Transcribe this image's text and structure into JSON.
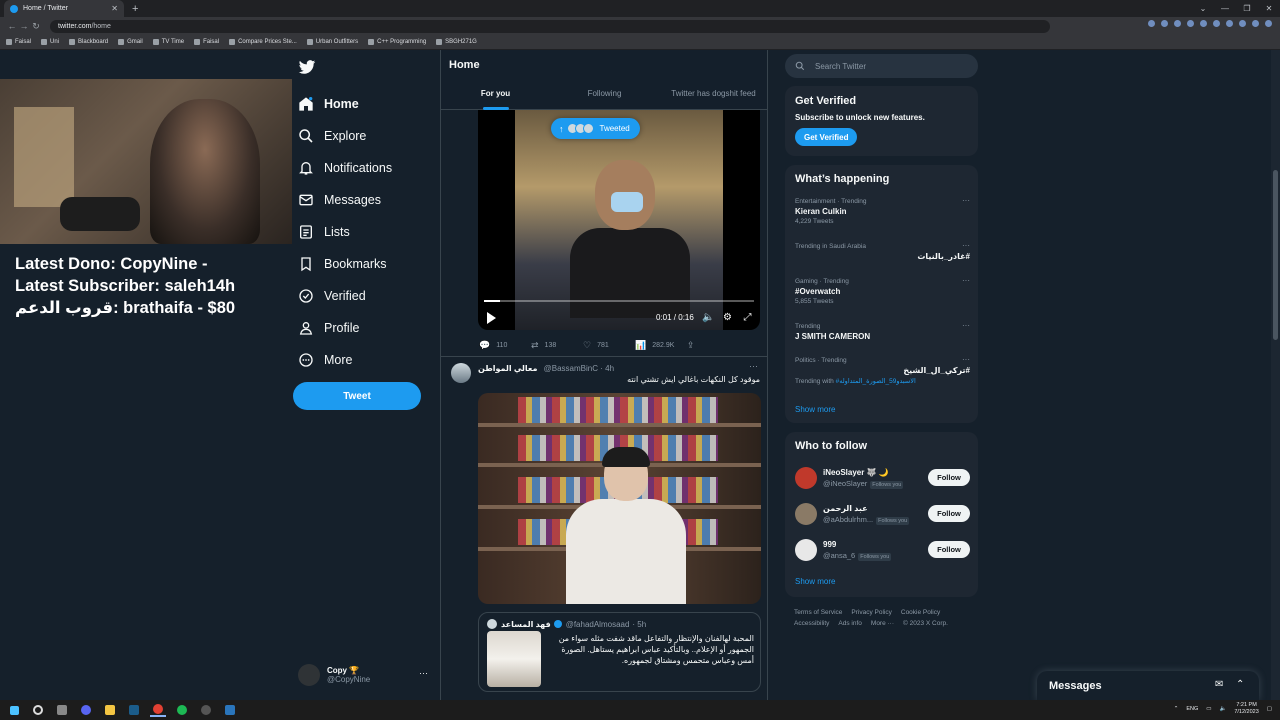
{
  "browser": {
    "tab_title": "Home / Twitter",
    "url_domain": "twitter.com",
    "url_path": "/home",
    "bookmarks": [
      "Faisal",
      "Uni",
      "Blackboard",
      "Gmail",
      "TV Time",
      "Faisal",
      "Compare Prices Ste...",
      "Urban Outfitters",
      "C++ Programming",
      "SBGH271G"
    ]
  },
  "stream": {
    "line1": "Latest Dono: CopyNine -",
    "line2": "Latest Subscriber: saleh14h",
    "line3": "قروب الدعم: brathaifa - $80"
  },
  "sidebar": {
    "items": [
      {
        "label": "Home",
        "icon": "home-icon"
      },
      {
        "label": "Explore",
        "icon": "search-icon"
      },
      {
        "label": "Notifications",
        "icon": "bell-icon"
      },
      {
        "label": "Messages",
        "icon": "envelope-icon"
      },
      {
        "label": "Lists",
        "icon": "list-icon"
      },
      {
        "label": "Bookmarks",
        "icon": "bookmark-icon"
      },
      {
        "label": "Verified",
        "icon": "verified-icon"
      },
      {
        "label": "Profile",
        "icon": "person-icon"
      },
      {
        "label": "More",
        "icon": "more-circle-icon"
      }
    ],
    "tweet_button": "Tweet",
    "account_name": "Copy 🏆",
    "account_handle": "@CopyNine"
  },
  "feed": {
    "title": "Home",
    "tabs": [
      "For you",
      "Following",
      "Twitter has dogshit feed"
    ],
    "new_tweets_pill": "Tweeted",
    "video": {
      "time": "0:01 / 0:16",
      "progress": 0.06
    },
    "video_actions": {
      "replies": "110",
      "retweets": "138",
      "likes": "781",
      "views": "282.9K"
    },
    "tweet2": {
      "display_name": "معالي المواطن",
      "handle": "@BassamBinC",
      "time": "· 4h",
      "text": "موقود كل النكهات باغالي ايش تشتي انته"
    },
    "quote": {
      "display_name": "فهد المساعد",
      "handle": "@fahadAlmosaad",
      "time": "· 5h",
      "text": "المحبة لهالفنان والإنتظار والتفاعل ماقد شفت مثله سواء من الجمهور أو الإعلام.. وبالتأكيد عباس ابراهيم يستاهل. الصورة أمس وعباس متحمس ومشتاق لجمهوره."
    }
  },
  "right": {
    "search_placeholder": "Search Twitter",
    "get_verified": {
      "title": "Get Verified",
      "subtitle": "Subscribe to unlock new features.",
      "button": "Get Verified"
    },
    "whats_happening": {
      "title": "What’s happening",
      "trends": [
        {
          "context": "Entertainment · Trending",
          "name": "Kieran Culkin",
          "count": "4,229 Tweets",
          "rtl": false
        },
        {
          "context": "Trending in Saudi Arabia",
          "name": "#غادر_بالنيات",
          "count": "",
          "rtl": true
        },
        {
          "context": "Gaming · Trending",
          "name": "#Overwatch",
          "count": "5,855 Tweets",
          "rtl": false
        },
        {
          "context": "Trending",
          "name": "J SMITH CAMERON",
          "count": "",
          "rtl": false
        },
        {
          "context": "Politics · Trending",
          "name": "#تركي_ال_الشيخ",
          "count": "Trending with",
          "link": "#الاسبدو59_الصورة_المتداوله",
          "rtl": true
        }
      ],
      "show_more": "Show more"
    },
    "who_to_follow": {
      "title": "Who to follow",
      "users": [
        {
          "name": "iNeoSlayer 🐺 🌙",
          "handle": "@iNeoSlayer",
          "follows_you": "Follows you",
          "button": "Follow",
          "color": "#c0392b"
        },
        {
          "name": "عبد الرحمن",
          "handle": "@aAbdulrhm...",
          "follows_you": "Follows you",
          "button": "Follow",
          "color": "#8a7a66"
        },
        {
          "name": "999",
          "handle": "@ansa_6",
          "follows_you": "Follows you",
          "button": "Follow",
          "color": "#e8e8e8"
        }
      ],
      "show_more": "Show more"
    },
    "footer": {
      "links": [
        "Terms of Service",
        "Privacy Policy",
        "Cookie Policy",
        "Accessibility",
        "Ads info",
        "More ···",
        "© 2023 X Corp."
      ]
    }
  },
  "messages_drawer": {
    "title": "Messages"
  },
  "taskbar": {
    "lang": "ENG",
    "time": "7:21 PM",
    "date": "7/12/2023"
  }
}
